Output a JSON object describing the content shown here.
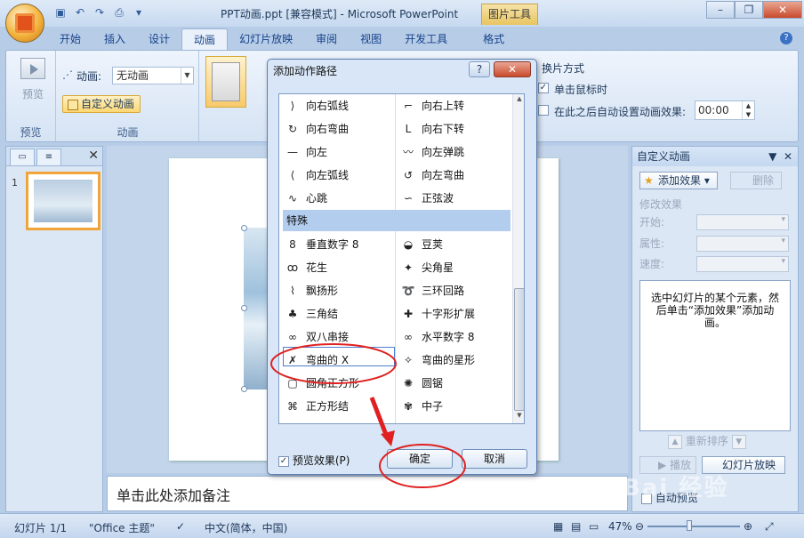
{
  "titlebar": {
    "title": "PPT动画.ppt [兼容模式] - Microsoft PowerPoint",
    "context_tab": "图片工具",
    "minimize": "–",
    "restore": "❐",
    "close": "✕"
  },
  "tabs": [
    "开始",
    "插入",
    "设计",
    "动画",
    "幻灯片放映",
    "审阅",
    "视图",
    "开发工具",
    "格式"
  ],
  "ribbon": {
    "preview_label": "预览",
    "preview_group": "预览",
    "animation_label": "动画:",
    "animation_value": "无动画",
    "custom_animation": "自定义动画",
    "animation_group": "动画",
    "switch_mode_title": "换片方式",
    "on_click_label": "单击鼠标时",
    "on_click_checked": true,
    "auto_after_label": "在此之后自动设置动画效果:",
    "auto_after_checked": false,
    "auto_after_time": "00:00"
  },
  "leftpane": {
    "slide_number": "1"
  },
  "notes_placeholder": "单击此处添加备注",
  "taskpane": {
    "title": "自定义动画",
    "add_effect": "添加效果",
    "delete": "删除",
    "modify_effect": "修改效果",
    "start_label": "开始:",
    "property_label": "属性:",
    "speed_label": "速度:",
    "hint": "选中幻灯片的某个元素，然后单击“添加效果”添加动画。",
    "reorder": "重新排序",
    "play": "播放",
    "slideshow": "幻灯片放映",
    "autopreview": "自动预览"
  },
  "statusbar": {
    "slide_info": "幻灯片 1/1",
    "theme": "\"Office 主题\"",
    "language": "中文(简体，中国)",
    "zoom": "47%"
  },
  "dialog": {
    "title": "添加动作路径",
    "help": "?",
    "close": "✕",
    "left_top_items": [
      {
        "icon": "right-arc-icon",
        "glyph": "⟩",
        "label": "向右弧线"
      },
      {
        "icon": "right-curve-icon",
        "glyph": "↻",
        "label": "向右弯曲"
      },
      {
        "icon": "left-line-icon",
        "glyph": "—",
        "label": "向左"
      },
      {
        "icon": "left-arc-icon",
        "glyph": "⟨",
        "label": "向左弧线"
      },
      {
        "icon": "heartbeat-icon",
        "glyph": "∿",
        "label": "心跳"
      }
    ],
    "right_top_items": [
      {
        "icon": "turn-up-right-icon",
        "glyph": "⌐",
        "label": "向右上转"
      },
      {
        "icon": "turn-down-right-icon",
        "glyph": "L",
        "label": "向右下转"
      },
      {
        "icon": "left-bounce-icon",
        "glyph": "〰",
        "label": "向左弹跳"
      },
      {
        "icon": "left-curve-icon",
        "glyph": "↺",
        "label": "向左弯曲"
      },
      {
        "icon": "sine-wave-icon",
        "glyph": "∽",
        "label": "正弦波"
      }
    ],
    "category": "特殊",
    "left_special_items": [
      {
        "icon": "vertical-eight-icon",
        "glyph": "8",
        "label": "垂直数字 8"
      },
      {
        "icon": "peanut-icon",
        "glyph": "ꝏ",
        "label": "花生"
      },
      {
        "icon": "pennant-icon",
        "glyph": "⌇",
        "label": "飘扬形"
      },
      {
        "icon": "trefoil-icon",
        "glyph": "♣",
        "label": "三角结"
      },
      {
        "icon": "double-eight-icon",
        "glyph": "∞",
        "label": "双八串接"
      },
      {
        "icon": "curved-x-icon",
        "glyph": "✗",
        "label": "弯曲的 X"
      },
      {
        "icon": "rounded-square-icon",
        "glyph": "▢",
        "label": "圆角正方形"
      },
      {
        "icon": "square-knot-icon",
        "glyph": "⌘",
        "label": "正方形结"
      }
    ],
    "right_special_items": [
      {
        "icon": "bean-icon",
        "glyph": "◒",
        "label": "豆荚"
      },
      {
        "icon": "pointy-star-icon",
        "glyph": "✦",
        "label": "尖角星"
      },
      {
        "icon": "loop-de-loop-icon",
        "glyph": "➰",
        "label": "三环回路"
      },
      {
        "icon": "cross-expand-icon",
        "glyph": "✚",
        "label": "十字形扩展"
      },
      {
        "icon": "horizontal-eight-icon",
        "glyph": "∞",
        "label": "水平数字 8"
      },
      {
        "icon": "curvy-star-icon",
        "glyph": "✧",
        "label": "弯曲的星形"
      },
      {
        "icon": "zigzag-circle-icon",
        "glyph": "✺",
        "label": "圆锯"
      },
      {
        "icon": "neutron-icon",
        "glyph": "✾",
        "label": "中子"
      }
    ],
    "preview_effect": "预览效果(P)",
    "preview_effect_checked": true,
    "ok": "确定",
    "cancel": "取消"
  },
  "watermark": "Bai 经验"
}
